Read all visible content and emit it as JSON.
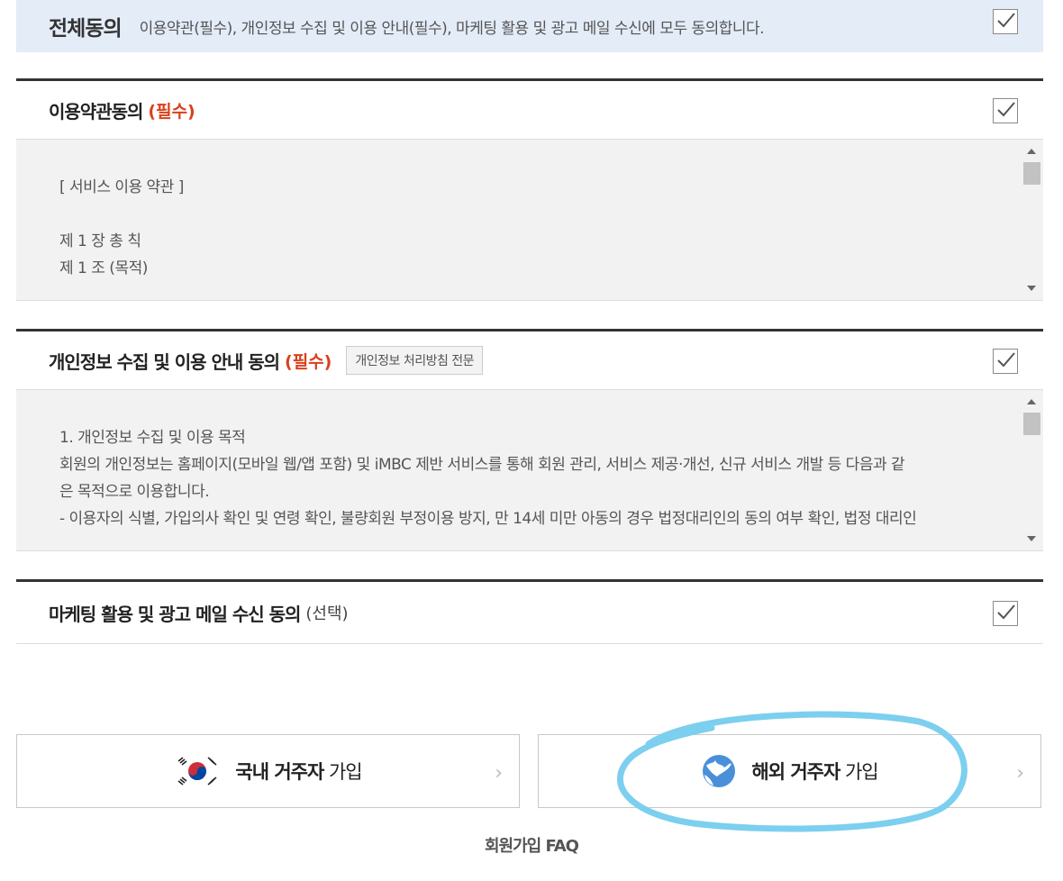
{
  "all_agree": {
    "title": "전체동의",
    "description": "이용약관(필수), 개인정보 수집 및 이용 안내(필수), 마케팅 활용 및 광고 메일 수신에 모두 동의합니다."
  },
  "terms": {
    "title": "이용약관동의",
    "required": "(필수)",
    "lines": [
      "",
      "[ 서비스 이용 약관 ]",
      "",
      "제 1 장 총 칙",
      "제 1 조 (목적)"
    ]
  },
  "privacy": {
    "title": "개인정보 수집 및 이용 안내 동의",
    "required": "(필수)",
    "policy_button": "개인정보 처리방침 전문",
    "lines": [
      "",
      "1. 개인정보 수집 및 이용 목적",
      "회원의 개인정보는 홈페이지(모바일 웹/앱 포함) 및 iMBC 제반 서비스를 통해 회원 관리, 서비스 제공·개선, 신규 서비스 개발 등 다음과 같",
      "은 목적으로 이용합니다.",
      "- 이용자의 식별, 가입의사 확인 및 연령 확인, 불량회원 부정이용 방지, 만 14세 미만 아동의 경우 법정대리인의 동의 여부 확인, 법정 대리인"
    ]
  },
  "marketing": {
    "title": "마케팅 활용 및 광고 메일 수신 동의",
    "optional": "(선택)"
  },
  "join": {
    "domestic_bold": "국내 거주자",
    "domestic_rest": " 가입",
    "overseas_bold": "해외 거주자",
    "overseas_rest": " 가입",
    "chevron": "›"
  },
  "faq": "회원가입 FAQ",
  "colors": {
    "accent_required": "#d9401c",
    "all_agree_bg": "#e4ecf8",
    "highlight": "#7ccfee"
  },
  "icons": {
    "domestic": "korea-flag-icon",
    "overseas": "globe-icon"
  }
}
